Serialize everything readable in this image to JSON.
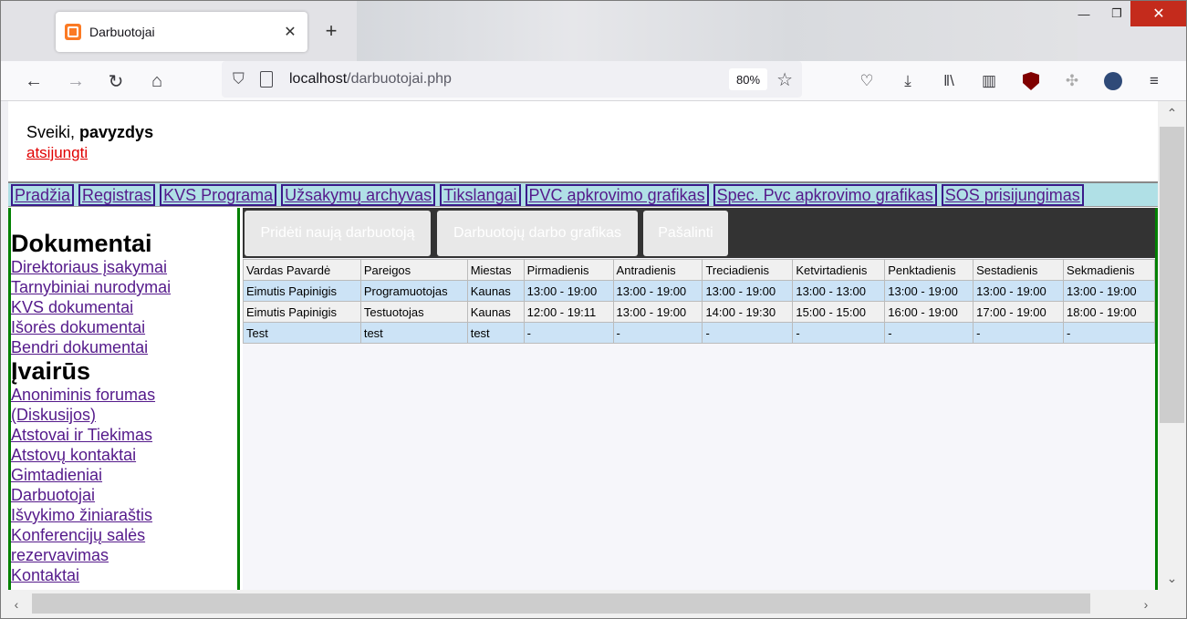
{
  "browser": {
    "tab_title": "Darbuotojai",
    "url_host": "localhost",
    "url_path": "/darbuotojai.php",
    "zoom": "80%"
  },
  "header": {
    "greeting": "Sveiki, ",
    "username": "pavyzdys",
    "logout": "atsijungti"
  },
  "menu": [
    "Pradžia",
    "Registras",
    "KVS Programa",
    "Užsakymų archyvas",
    "Tikslangai",
    "PVC apkrovimo grafikas",
    "Spec. Pvc apkrovimo grafikas",
    "SOS prisijungimas"
  ],
  "sidebar": {
    "section1": "Dokumentai",
    "docs": [
      "Direktoriaus įsakymai",
      "Tarnybiniai nurodymai",
      "KVS dokumentai",
      "Išorės dokumentai",
      "Bendri dokumentai"
    ],
    "section2": "Įvairūs",
    "misc": [
      "Anoniminis forumas (Diskusijos)",
      "Atstovai ir Tiekimas",
      "Atstovų kontaktai",
      "Gimtadieniai",
      "Darbuotojai",
      "Išvykimo žiniaraštis",
      "Konferencijų salės rezervavimas",
      "Kontaktai"
    ]
  },
  "actions": {
    "add": "Pridėti naują darbuotoją",
    "schedule": "Darbuotojų darbo grafikas",
    "remove": "Pašalinti"
  },
  "table": {
    "headers": [
      "Vardas Pavardė",
      "Pareigos",
      "Miestas",
      "Pirmadienis",
      "Antradienis",
      "Treciadienis",
      "Ketvirtadienis",
      "Penktadienis",
      "Sestadienis",
      "Sekmadienis"
    ],
    "rows": [
      [
        "Eimutis Papinigis",
        "Programuotojas",
        "Kaunas",
        "13:00 - 19:00",
        "13:00 - 19:00",
        "13:00 - 19:00",
        "13:00 - 13:00",
        "13:00 - 19:00",
        "13:00 - 19:00",
        "13:00 - 19:00"
      ],
      [
        "Eimutis Papinigis",
        "Testuotojas",
        "Kaunas",
        "12:00 - 19:11",
        "13:00 - 19:00",
        "14:00 - 19:30",
        "15:00 - 15:00",
        "16:00 - 19:00",
        "17:00 - 19:00",
        "18:00 - 19:00"
      ],
      [
        "Test",
        "test",
        "test",
        "-",
        "-",
        "-",
        "-",
        "-",
        "-",
        "-"
      ]
    ]
  }
}
